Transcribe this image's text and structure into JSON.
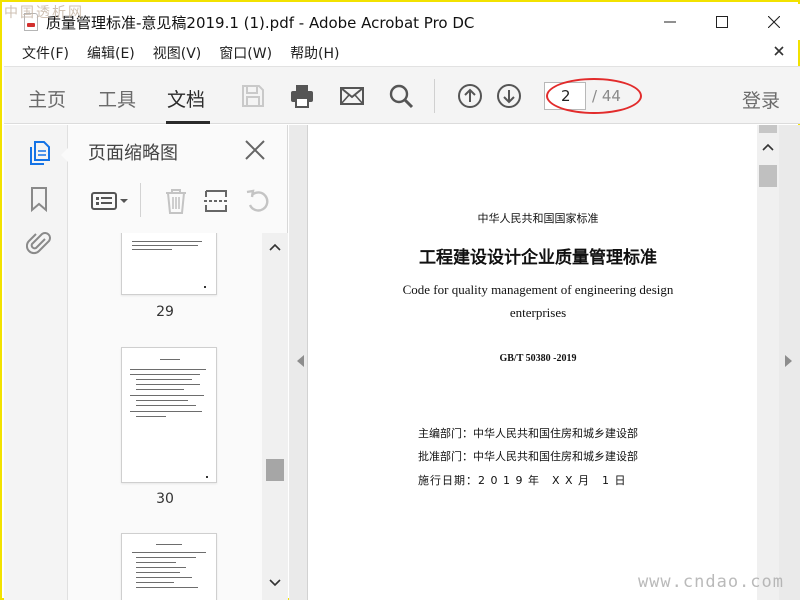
{
  "window": {
    "title": "质量管理标准-意见稿2019.1 (1).pdf - Adobe Acrobat Pro DC"
  },
  "watermarks": {
    "top": "中国透析网",
    "bottom": "www.cndao.com"
  },
  "menu": {
    "items": [
      "文件(F)",
      "编辑(E)",
      "视图(V)",
      "窗口(W)",
      "帮助(H)"
    ]
  },
  "toolbar": {
    "tabs": [
      "主页",
      "工具",
      "文档"
    ],
    "active_tab": "文档",
    "icons": [
      "save-icon",
      "print-icon",
      "email-icon",
      "search-icon",
      "page-up-icon",
      "page-down-icon"
    ],
    "current_page": "2",
    "total_pages": "/ 44",
    "login_label": "登录",
    "annotation_color": "#e22b2b"
  },
  "left_rail": {
    "icons": [
      "page-thumbnails-icon",
      "bookmark-icon",
      "attachment-icon"
    ],
    "active_color": "#1473e6"
  },
  "thumbnail_panel": {
    "title": "页面缩略图",
    "tools": [
      "thumbnail-options-icon",
      "delete-icon",
      "extract-icon",
      "rotate-icon"
    ],
    "pages": [
      {
        "number": "29"
      },
      {
        "number": "30"
      },
      {
        "number": ""
      }
    ]
  },
  "document": {
    "standard_label": "中华人民共和国国家标准",
    "title_cn": "工程建设设计企业质量管理标准",
    "title_en_line1": "Code for quality management of engineering design",
    "title_en_line2": "enterprises",
    "code": "GB/T 50380 -2019",
    "chief_editor": "主编部门：中华人民共和国住房和城乡建设部",
    "approver": "批准部门：中华人民共和国住房和城乡建设部",
    "effective_date": "施行日期：2 0 1 9 年　X X 月　1 日"
  }
}
